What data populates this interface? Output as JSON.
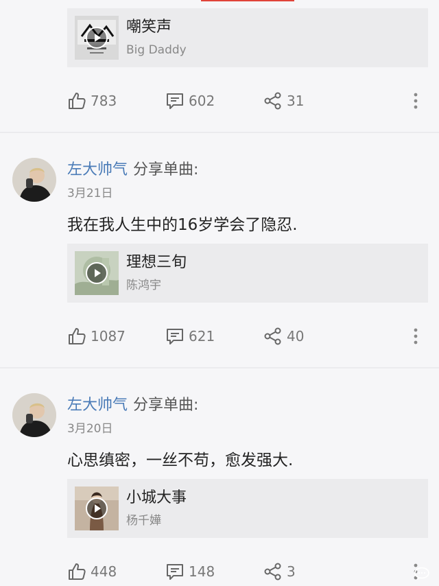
{
  "colors": {
    "accent": "#e0443a",
    "author_name": "#4a7bb7",
    "card_bg": "#ebebed",
    "page_bg": "#f6f6f8",
    "muted_text": "#888888"
  },
  "posts": [
    {
      "song": {
        "title": "嘲笑声",
        "artist": "Big Daddy"
      },
      "actions": {
        "likes": "783",
        "comments": "602",
        "shares": "31"
      }
    },
    {
      "author": "左大帅气",
      "action": "分享单曲:",
      "date": "3月21日",
      "text": "我在我人生中的16岁学会了隐忍.",
      "song": {
        "title": "理想三旬",
        "artist": "陈鸿宇"
      },
      "actions": {
        "likes": "1087",
        "comments": "621",
        "shares": "40"
      }
    },
    {
      "author": "左大帅气",
      "action": "分享单曲:",
      "date": "3月20日",
      "text": "心思缜密，一丝不苟，愈发强大.",
      "song": {
        "title": "小城大事",
        "artist": "杨千嬅"
      },
      "actions": {
        "likes": "448",
        "comments": "148",
        "shares": "3"
      }
    }
  ],
  "icons": [
    "like-icon",
    "comment-icon",
    "share-icon",
    "more-icon",
    "play-icon"
  ]
}
